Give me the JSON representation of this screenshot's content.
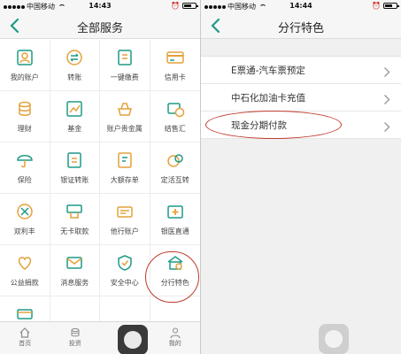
{
  "colors": {
    "accent": "#1e9a86",
    "highlight": "#c0392b",
    "icon_orange": "#e4a13a"
  },
  "left": {
    "status": {
      "carrier": "中国移动",
      "time": "14:43",
      "battery": ""
    },
    "title": "全部服务",
    "services": [
      {
        "label": "我的账户",
        "icon": "account-icon"
      },
      {
        "label": "转账",
        "icon": "transfer-icon"
      },
      {
        "label": "一键缴费",
        "icon": "payment-icon"
      },
      {
        "label": "信用卡",
        "icon": "credit-card-icon"
      },
      {
        "label": "理财",
        "icon": "finance-icon"
      },
      {
        "label": "基金",
        "icon": "fund-icon"
      },
      {
        "label": "账户贵金属",
        "icon": "precious-metal-icon"
      },
      {
        "label": "结售汇",
        "icon": "exchange-icon"
      },
      {
        "label": "保险",
        "icon": "umbrella-icon"
      },
      {
        "label": "银证转账",
        "icon": "securities-transfer-icon"
      },
      {
        "label": "大额存单",
        "icon": "deposit-icon"
      },
      {
        "label": "定活互转",
        "icon": "fixed-current-icon"
      },
      {
        "label": "双利丰",
        "icon": "interest-icon"
      },
      {
        "label": "无卡取款",
        "icon": "cardless-withdraw-icon"
      },
      {
        "label": "他行账户",
        "icon": "other-bank-icon"
      },
      {
        "label": "银医直通",
        "icon": "medical-icon"
      },
      {
        "label": "公益捐款",
        "icon": "donation-icon"
      },
      {
        "label": "消息服务",
        "icon": "message-icon"
      },
      {
        "label": "安全中心",
        "icon": "security-icon"
      },
      {
        "label": "分行特色",
        "icon": "branch-icon"
      }
    ],
    "tabs": [
      {
        "label": "首页",
        "icon": "home-icon"
      },
      {
        "label": "投资",
        "icon": "invest-icon"
      },
      {
        "label": "商城",
        "icon": "mall-icon"
      },
      {
        "label": "我的",
        "icon": "profile-icon"
      }
    ]
  },
  "right": {
    "status": {
      "carrier": "中国移动",
      "time": "14:44",
      "battery": ""
    },
    "title": "分行特色",
    "items": [
      {
        "label": "E票通-汽车票预定"
      },
      {
        "label": "中石化加油卡充值"
      },
      {
        "label": "现金分期付款"
      }
    ]
  }
}
